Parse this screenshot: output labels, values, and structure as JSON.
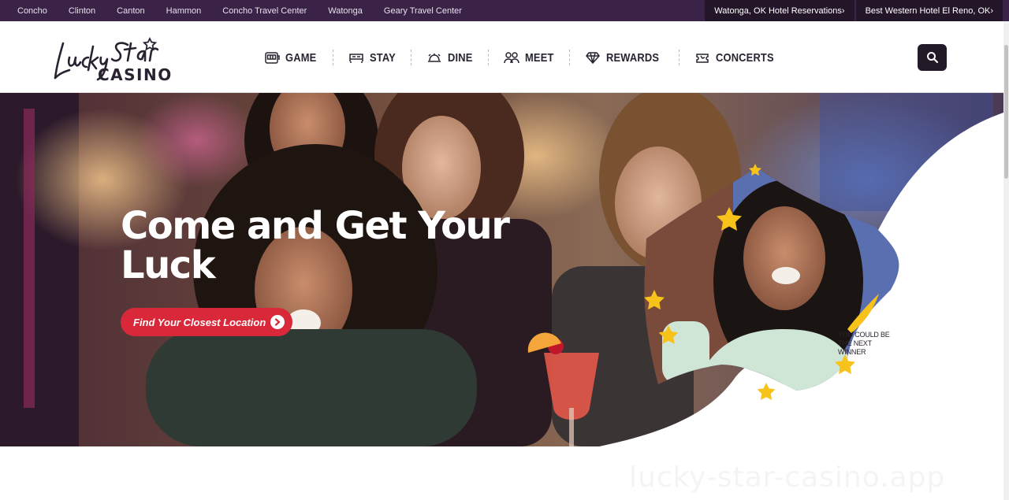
{
  "topbar": {
    "locations": [
      "Concho",
      "Clinton",
      "Canton",
      "Hammon",
      "Concho Travel Center",
      "Watonga",
      "Geary Travel Center"
    ],
    "right_links": [
      "Watonga, OK Hotel Reservations›",
      "Best Western Hotel El Reno, OK›"
    ]
  },
  "header": {
    "logo_text": "Lucky Star Casino",
    "nav": [
      {
        "label": "GAME",
        "icon": "slot-machine-icon"
      },
      {
        "label": "STAY",
        "icon": "bed-icon"
      },
      {
        "label": "DINE",
        "icon": "cloche-icon"
      },
      {
        "label": "MEET",
        "icon": "people-icon"
      },
      {
        "label": "REWARDS",
        "icon": "diamond-icon"
      },
      {
        "label": "CONCERTS",
        "icon": "ticket-icon"
      }
    ],
    "search_icon": "search-icon"
  },
  "hero": {
    "title": "Come and Get Your Luck",
    "cta_label": "Find Your Closest Location",
    "cta_icon": "arrow-right-circle-icon",
    "winner_caption": "YOU COULD BE THE NEXT WINNER"
  },
  "watermark": "lucky-star-casino.app",
  "colors": {
    "topbar": "#3b2247",
    "topbar_right": "#241629",
    "cta": "#d9283a",
    "star": "#f7c21a",
    "nav_text": "#2a2230"
  }
}
